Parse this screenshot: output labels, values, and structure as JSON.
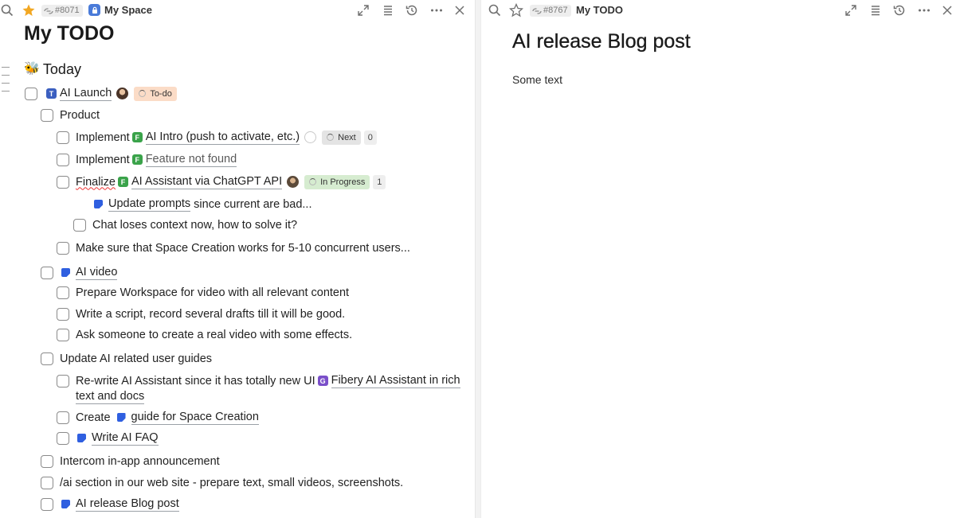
{
  "left": {
    "id": "#8071",
    "space": "My Space",
    "title": "My TODO",
    "section": "Today",
    "items": [
      {
        "pre": "",
        "tag": "T",
        "text": "AI Launch",
        "status": "To-do"
      },
      {
        "pre": "",
        "text": "Product"
      },
      {
        "pre": "Implement",
        "tag": "F",
        "text": "AI Intro (push to activate, etc.)",
        "status": "Next",
        "count": "0"
      },
      {
        "pre": "Implement",
        "tag": "F",
        "text": "Feature not found"
      },
      {
        "pre": "Finalize",
        "tag": "F",
        "text": "AI Assistant via ChatGPT API",
        "status": "In Progress",
        "count": "1"
      },
      {
        "link": "Update prompts",
        "text": "since current are bad..."
      },
      {
        "text": "Chat loses context now, how to solve it?"
      },
      {
        "text": "Make sure that Space Creation works for 5-10 concurrent users..."
      },
      {
        "link": "AI video"
      },
      {
        "text": "Prepare Workspace for video with all relevant content"
      },
      {
        "text": "Write a script, record several drafts till it will be good."
      },
      {
        "text": "Ask someone to create a real video with some effects."
      },
      {
        "text": "Update AI related user guides"
      },
      {
        "text": "Re-write AI Assistant since it has totally new UI",
        "tag": "G",
        "link": "Fibery AI Assistant in rich",
        "link2": "text and docs"
      },
      {
        "pre": "Create",
        "link": "guide for Space Creation"
      },
      {
        "link": "Write AI FAQ"
      },
      {
        "text": "Intercom in-app announcement"
      },
      {
        "text": "/ai section in our web site - prepare text, small videos, screenshots."
      },
      {
        "link": "AI release Blog post"
      }
    ]
  },
  "right": {
    "id": "#8767",
    "breadcrumb": "My TODO",
    "title": "AI release Blog post",
    "body": "Some text"
  }
}
